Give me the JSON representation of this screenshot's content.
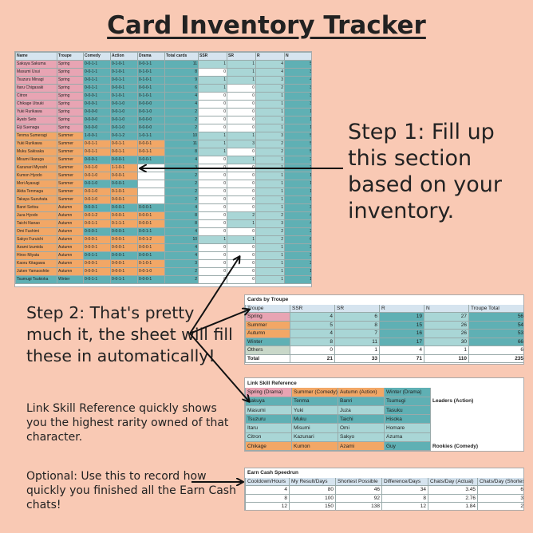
{
  "title": "Card Inventory Tracker",
  "step1": "Step 1: Fill up this section based on your inventory.",
  "step2": "Step 2: That's pretty much it, the sheet will fill these in automatically!",
  "link_desc": "Link Skill Reference quickly shows you the highest rarity owned of that character.",
  "optional": "Optional: Use this to record how quickly you finished all the Earn Cash chats!",
  "colors": {
    "background": "#f9c9b4",
    "spring": "#e8a4b3",
    "summer": "#f2a766",
    "autumn": "#f2a766",
    "teal": "#5fb0b4",
    "tealLight": "#a9d6d6",
    "blueHead": "#d6e4ef"
  },
  "inventory": {
    "headers": [
      "Name",
      "Troupe",
      "Comedy",
      "Action",
      "Drama",
      "Total cards",
      "SSR",
      "SR",
      "R",
      "N"
    ],
    "rows": [
      [
        "Sakuya Sakuma",
        "Spring",
        "0-0-1-1",
        "0-1-0-1",
        "0-0-1-1",
        "11",
        "1",
        "1",
        "4",
        "5"
      ],
      [
        "Masumi Usui",
        "Spring",
        "0-0-1-1",
        "0-1-0-1",
        "0-1-0-1",
        "8",
        "0",
        "1",
        "4",
        "3"
      ],
      [
        "Tsuzuru Minagi",
        "Spring",
        "0-0-1-1",
        "0-0-1-1",
        "0-1-0-1",
        "9",
        "1",
        "1",
        "3",
        "4"
      ],
      [
        "Itaru Chigasaki",
        "Spring",
        "0-0-1-1",
        "0-0-0-1",
        "0-0-0-1",
        "6",
        "1",
        "0",
        "2",
        "3"
      ],
      [
        "Citron",
        "Spring",
        "0-0-0-1",
        "0-1-0-1",
        "0-1-0-1",
        "4",
        "0",
        "0",
        "1",
        "3"
      ],
      [
        "Chikage Utsuki",
        "Spring",
        "0-0-0-1",
        "0-0-1-0",
        "0-0-0-0",
        "4",
        "0",
        "0",
        "1",
        "3"
      ],
      [
        "Yuki Rurikawa",
        "Spring",
        "0-0-0-0",
        "0-0-1-0",
        "0-0-1-0",
        "2",
        "0",
        "0",
        "1",
        "1"
      ],
      [
        "Ayato Seto",
        "Spring",
        "0-0-0-0",
        "0-0-1-0",
        "0-0-0-0",
        "2",
        "0",
        "0",
        "1",
        "1"
      ],
      [
        "Eiji Suenaga",
        "Spring",
        "0-0-0-0",
        "0-0-1-0",
        "0-0-0-0",
        "2",
        "0",
        "0",
        "1",
        "1"
      ],
      [
        "Tenma Sumeragi",
        "Summer",
        "1-0-0-1",
        "0-0-1-2",
        "1-0-1-1",
        "10",
        "1",
        "1",
        "3",
        "5"
      ],
      [
        "Yuki Rurikawa",
        "Summer",
        "0-0-1-1",
        "0-0-1-1",
        "0-0-0-1",
        "11",
        "1",
        "3",
        "2",
        "5"
      ],
      [
        "Muku Sakisaka",
        "Summer",
        "0-0-1-1",
        "0-0-1-1",
        "0-0-1-1",
        "8",
        "1",
        "0",
        "2",
        "5"
      ],
      [
        "Misumi Ikaruga",
        "Summer",
        "0-0-0-1",
        "0-0-0-1",
        "0-0-0-1",
        "4",
        "0",
        "1",
        "1",
        "2"
      ],
      [
        "Kazunari Miyoshi",
        "Summer",
        "0-0-1-0",
        "1-1-0-1",
        "",
        "3",
        "0",
        "0",
        "1",
        "2"
      ],
      [
        "Kumon Hyodo",
        "Summer",
        "0-0-1-0",
        "0-0-0-1",
        "",
        "2",
        "0",
        "0",
        "1",
        "1"
      ],
      [
        "Mori Ayasugi",
        "Summer",
        "0-0-1-0",
        "0-0-0-1",
        "",
        "2",
        "0",
        "0",
        "1",
        "1"
      ],
      [
        "Akita Tenmaga",
        "Summer",
        "0-0-1-0",
        "0-1-0-1",
        "",
        "2",
        "0",
        "0",
        "1",
        "1"
      ],
      [
        "Takaya Suzuhata",
        "Summer",
        "0-0-1-0",
        "0-0-0-1",
        "",
        "2",
        "0",
        "0",
        "1",
        "1"
      ],
      [
        "Banri Settsu",
        "Autumn",
        "0-0-0-1",
        "0-0-0-1",
        "0-0-0-1",
        "4",
        "0",
        "0",
        "1",
        "3"
      ],
      [
        "Juza Hyodo",
        "Autumn",
        "0-0-1-2",
        "0-0-0-1",
        "0-0-0-1",
        "8",
        "0",
        "2",
        "2",
        "4"
      ],
      [
        "Taichi Nanao",
        "Autumn",
        "0-0-1-1",
        "0-1-1-1",
        "0-0-0-1",
        "8",
        "0",
        "1",
        "3",
        "4"
      ],
      [
        "Omi Fushimi",
        "Autumn",
        "0-0-0-1",
        "0-0-0-1",
        "0-0-1-1",
        "4",
        "0",
        "0",
        "2",
        "2"
      ],
      [
        "Sakyo Furuichi",
        "Autumn",
        "0-0-0-1",
        "0-0-0-1",
        "0-0-1-2",
        "10",
        "1",
        "1",
        "2",
        "6"
      ],
      [
        "Azami Izumida",
        "Autumn",
        "0-0-0-1",
        "0-0-0-1",
        "0-0-0-1",
        "4",
        "0",
        "0",
        "1",
        "3"
      ],
      [
        "Hiroo Miyata",
        "Autumn",
        "0-0-1-1",
        "0-0-0-1",
        "0-0-0-1",
        "4",
        "0",
        "0",
        "1",
        "3"
      ],
      [
        "Kaoru Kitagawa",
        "Autumn",
        "0-0-0-1",
        "0-0-0-1",
        "0-1-0-1",
        "3",
        "0",
        "0",
        "1",
        "2"
      ],
      [
        "Juken Yamaoshite",
        "Autumn",
        "0-0-0-1",
        "0-0-0-1",
        "0-0-1-0",
        "2",
        "0",
        "0",
        "1",
        "1"
      ],
      [
        "Tsumugi Tsukioka",
        "Winter",
        "0-0-1-1",
        "0-0-1-1",
        "0-0-0-1",
        "2",
        "0",
        "0",
        "1",
        "1"
      ]
    ]
  },
  "troupe": {
    "title": "Cards by Troupe",
    "headers": [
      "Troupe",
      "SSR",
      "SR",
      "R",
      "N",
      "Troupe Total"
    ],
    "rows": [
      [
        "Spring",
        "4",
        "6",
        "19",
        "27",
        "56"
      ],
      [
        "Summer",
        "5",
        "8",
        "15",
        "26",
        "54"
      ],
      [
        "Autumn",
        "4",
        "7",
        "16",
        "26",
        "53"
      ],
      [
        "Winter",
        "8",
        "11",
        "17",
        "30",
        "66"
      ],
      [
        "Others",
        "0",
        "1",
        "4",
        "1",
        "6"
      ],
      [
        "Total",
        "21",
        "33",
        "71",
        "110",
        "235"
      ]
    ]
  },
  "link": {
    "title": "Link Skill Reference",
    "headers": [
      "Spring (Drama)",
      "Summer (Comedy)",
      "Autumn (Action)",
      "Winter (Drama)"
    ],
    "rows": [
      [
        "Sakuya",
        "Tenma",
        "Banri",
        "Tsumugi"
      ],
      [
        "Masumi",
        "Yuki",
        "Juza",
        "Tasuku"
      ],
      [
        "Tsuzuru",
        "Muku",
        "Taichi",
        "Hisoka"
      ],
      [
        "Itaru",
        "Misumi",
        "Omi",
        "Homare"
      ],
      [
        "Citron",
        "Kazunari",
        "Sakyo",
        "Azuma"
      ],
      [
        "Chikage",
        "Kumon",
        "Azami",
        "Guy"
      ]
    ],
    "note_leaders": "Leaders (Action)",
    "note_rookies": "Rookies (Comedy)"
  },
  "cash": {
    "title": "Earn Cash Speedrun",
    "headers": [
      "Cooldown/Hours",
      "My Result/Days",
      "Shortest Possible",
      "Difference/Days",
      "Chats/Day (Actual)",
      "Chats/Day (Shortest)"
    ],
    "rows": [
      [
        "4",
        "80",
        "46",
        "34",
        "3.45",
        "6"
      ],
      [
        "8",
        "100",
        "92",
        "8",
        "2.76",
        "3"
      ],
      [
        "12",
        "150",
        "138",
        "12",
        "1.84",
        "2"
      ]
    ]
  }
}
